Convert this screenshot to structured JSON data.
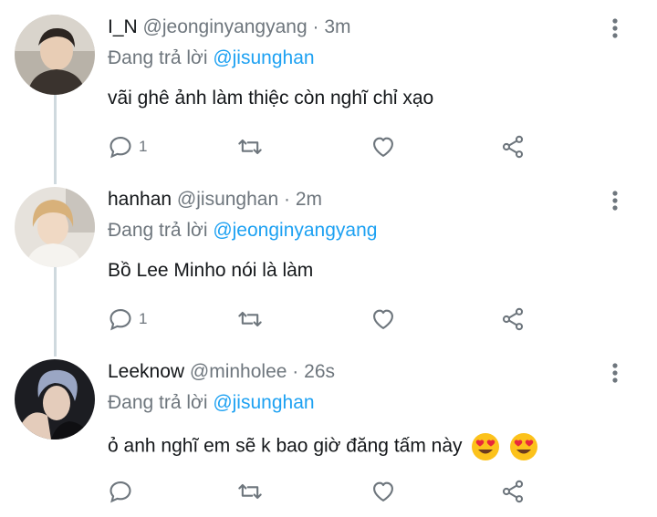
{
  "tweets": [
    {
      "display_name": "I_N",
      "handle": "@jeonginyangyang",
      "dot": "·",
      "time": "3m",
      "replying_label": "Đang trả lời",
      "replying_to": "@jisunghan",
      "text": "vãi ghê ảnh làm thiệc còn nghĩ chỉ xạo",
      "reply_count": "1",
      "avatar_icon": "person-avatar-hoodie"
    },
    {
      "display_name": "hanhan",
      "handle": "@jisunghan",
      "dot": "·",
      "time": "2m",
      "replying_label": "Đang trả lời",
      "replying_to": "@jeonginyangyang",
      "text": "Bồ Lee Minho nói là làm",
      "reply_count": "1",
      "avatar_icon": "person-avatar-blond"
    },
    {
      "display_name": "Leeknow",
      "handle": "@minholee",
      "dot": "·",
      "time": "26s",
      "replying_label": "Đang trả lời",
      "replying_to": "@jisunghan",
      "text": "ỏ anh nghĩ em sẽ k bao giờ đăng tấm này",
      "emojis": [
        "heart-eyes-emoji",
        "heart-eyes-emoji"
      ],
      "reply_count": "",
      "avatar_icon": "person-avatar-dark"
    }
  ],
  "colors": {
    "text": "#14171a",
    "muted": "#6e767d",
    "link": "#1da1f2",
    "thread_line": "#cfd9de"
  },
  "icons": [
    "reply-icon",
    "retweet-icon",
    "like-icon",
    "share-icon",
    "more-icon"
  ]
}
